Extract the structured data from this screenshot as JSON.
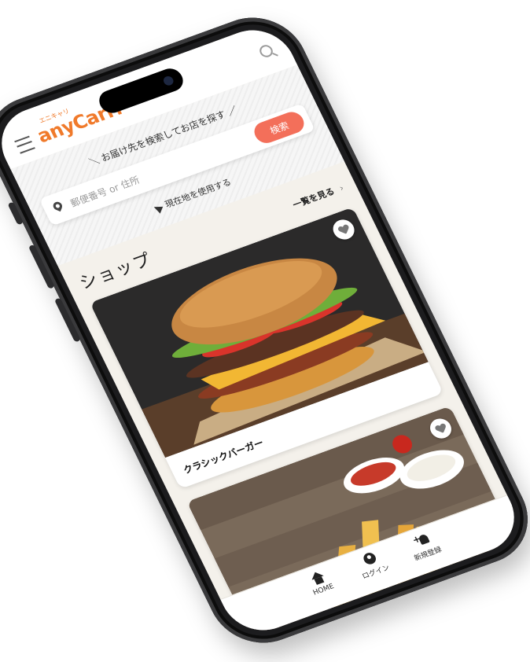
{
  "header": {
    "logo_ruby": "エニキャリ",
    "logo_text": "anyCarri"
  },
  "search": {
    "title": "＼ お届け先を検索してお店を探す ／",
    "placeholder": "郵便番号 or 住所",
    "button_label": "検索",
    "geolocation_label": "現在地を使用する"
  },
  "shops": {
    "section_title": "ショップ",
    "see_all_label": "一覧を見る",
    "items": [
      {
        "name": "クラシックバーガー",
        "image": "burger-photo"
      },
      {
        "name": "",
        "image": "fries-photo"
      }
    ]
  },
  "tabbar": {
    "home_label": "HOME",
    "login_label": "ログイン",
    "register_label": "新規登録"
  },
  "colors": {
    "brand": "#f07a2b",
    "search_button": "#f36f5a",
    "page_background": "#f4f1eb"
  }
}
